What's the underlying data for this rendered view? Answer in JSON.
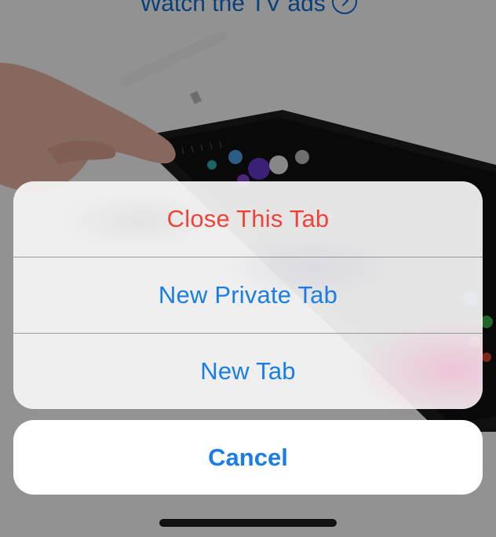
{
  "background": {
    "link_text": "Watch the TV ads",
    "link_icon": "circle-arrow-right-icon",
    "hero_image": "hand-with-pencil-on-tablet"
  },
  "action_sheet": {
    "items": [
      {
        "label": "Close This Tab",
        "style": "destructive",
        "color": "#f0433a"
      },
      {
        "label": "New Private Tab",
        "style": "default",
        "color": "#1a7ee6"
      },
      {
        "label": "New Tab",
        "style": "default",
        "color": "#1a7ee6"
      }
    ],
    "cancel_label": "Cancel"
  },
  "colors": {
    "accent": "#1a7ee6",
    "destructive": "#f0433a"
  }
}
